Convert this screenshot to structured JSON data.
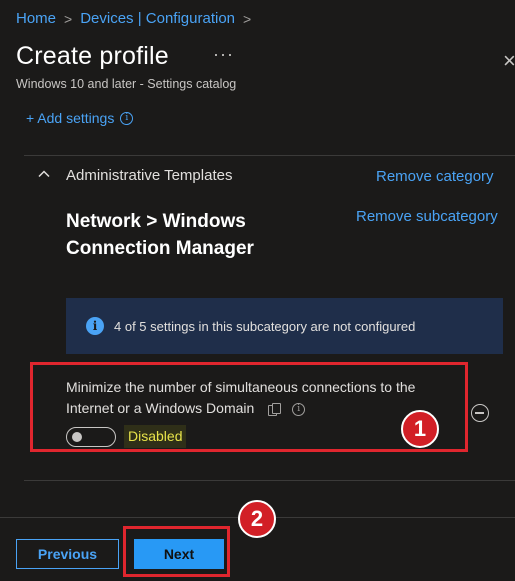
{
  "breadcrumb": {
    "items": [
      "Home",
      "Devices | Configuration"
    ],
    "separator": ">"
  },
  "header": {
    "title": "Create profile",
    "more_glyph": "···",
    "close_glyph": "×",
    "subtitle": "Windows 10 and later - Settings catalog"
  },
  "add_settings": {
    "label": "+ Add settings",
    "info_glyph": "i"
  },
  "category": {
    "title": "Administrative Templates",
    "remove_label": "Remove category",
    "expanded": true
  },
  "subcategory": {
    "title": "Network > Windows Connection Manager",
    "remove_label": "Remove subcategory"
  },
  "info_banner": {
    "icon_glyph": "i",
    "text": "4 of 5 settings in this subcategory are not configured"
  },
  "setting": {
    "label": "Minimize the number of simultaneous connections to the Internet or a Windows Domain",
    "info_glyph": "i",
    "toggle_state": "Disabled",
    "enabled": false
  },
  "annotations": {
    "badge_1": "1",
    "badge_2": "2"
  },
  "footer": {
    "previous_label": "Previous",
    "next_label": "Next"
  },
  "colors": {
    "background": "#1b1a19",
    "link": "#4aa3f5",
    "primary_button": "#2899f5",
    "highlight": "#e0262e",
    "banner": "#1f2e4a",
    "disabled_text": "#e8e44a"
  }
}
